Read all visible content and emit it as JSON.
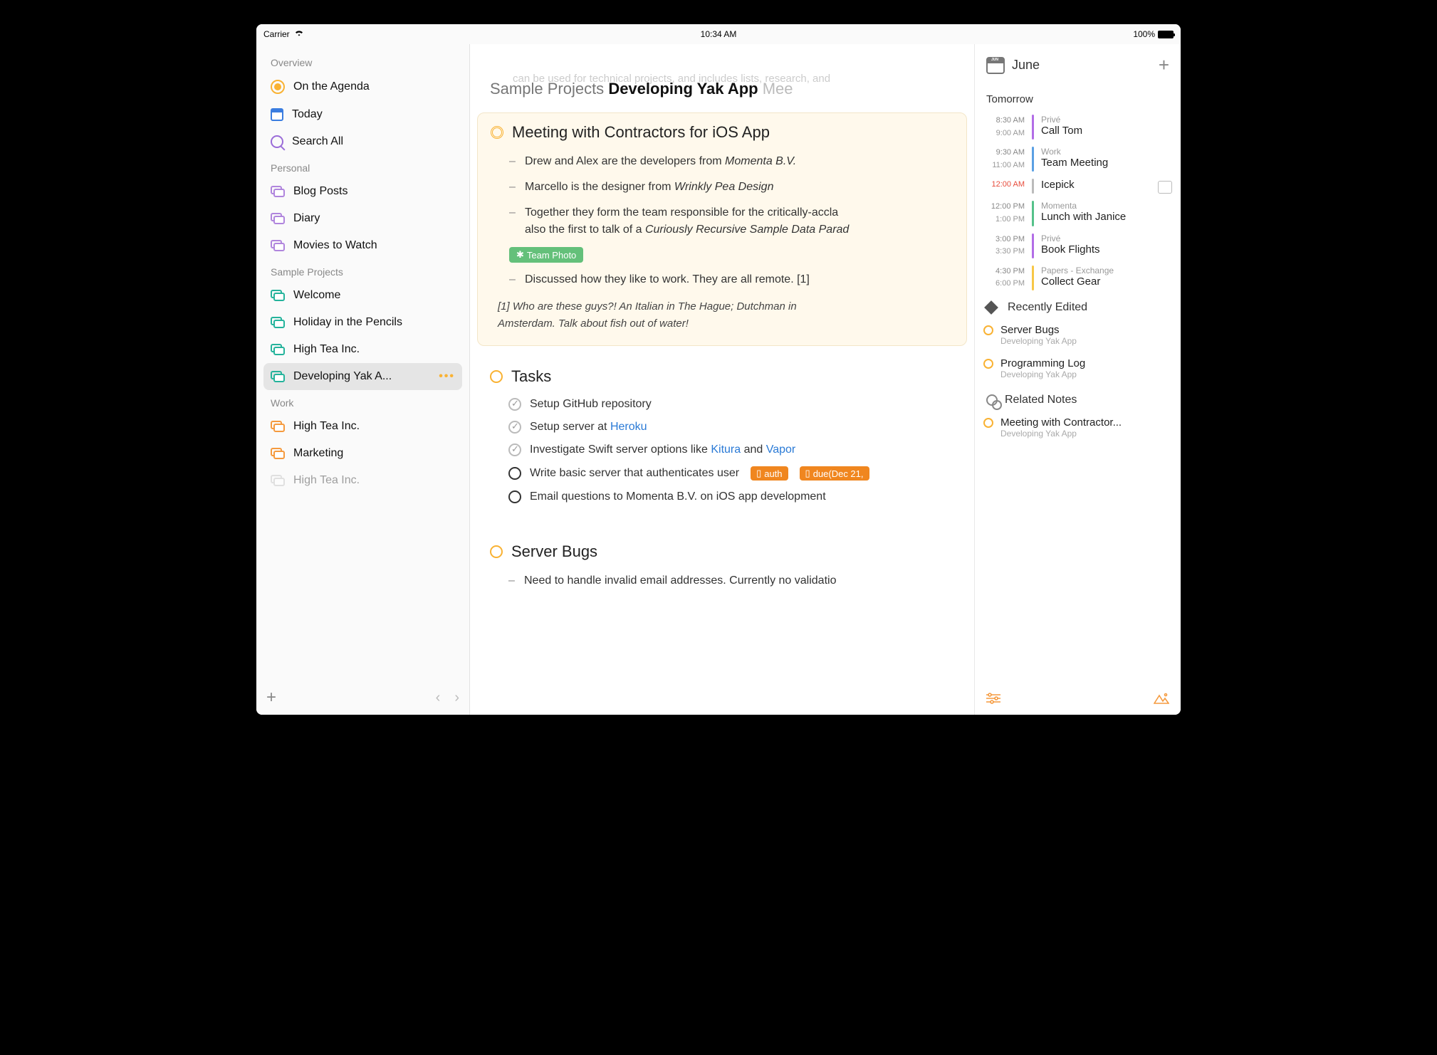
{
  "status": {
    "carrier": "Carrier",
    "time": "10:34 AM",
    "battery_pct": "100%"
  },
  "sidebar": {
    "sections": {
      "overview": "Overview",
      "personal": "Personal",
      "sample": "Sample Projects",
      "work": "Work"
    },
    "overview": [
      {
        "label": "On the Agenda"
      },
      {
        "label": "Today"
      },
      {
        "label": "Search All"
      }
    ],
    "personal": [
      "Blog Posts",
      "Diary",
      "Movies to Watch"
    ],
    "sample": [
      "Welcome",
      "Holiday in the Pencils",
      "High Tea Inc.",
      "Developing Yak A..."
    ],
    "work": [
      "High Tea Inc.",
      "Marketing",
      "High Tea Inc."
    ]
  },
  "breadcrumb": {
    "p1": "Sample Projects",
    "p2": "Developing Yak App",
    "p3": "Mee"
  },
  "faded_lead": "can be used for technical projects, and includes lists, research, and",
  "note1": {
    "title": "Meeting with Contractors for iOS App",
    "lines": [
      {
        "pre": "Drew and Alex are the developers from ",
        "em": "Momenta B.V."
      },
      {
        "pre": "Marcello is the designer from ",
        "em": "Wrinkly Pea Design"
      },
      {
        "pre": "Together they form the team responsible for the critically-accla",
        "pre2": "also the first to talk of a ",
        "em": "Curiously Recursive Sample Data Parad"
      }
    ],
    "tag": "Team Photo",
    "line4": "Discussed how they like to work. They are all remote. [1]",
    "footnote": "[1] Who are these guys?! An Italian in The Hague; Dutchman in ",
    "footnote2": "Amsterdam. Talk about fish out of water!"
  },
  "tasks": {
    "title": "Tasks",
    "items": [
      {
        "done": true,
        "text": "Setup GitHub repository"
      },
      {
        "done": true,
        "pre": "Setup server at ",
        "link": "Heroku"
      },
      {
        "done": true,
        "pre": "Investigate Swift server options like ",
        "link1": "Kitura",
        "mid": " and ",
        "link2": "Vapor"
      },
      {
        "done": false,
        "text": "Write basic server that authenticates user",
        "tag1": "auth",
        "tag2": "due(Dec 21,"
      },
      {
        "done": false,
        "text": "Email questions to Momenta B.V. on iOS app development"
      }
    ]
  },
  "bugs": {
    "title": "Server Bugs",
    "line": "Need to handle invalid email addresses. Currently no validatio"
  },
  "right": {
    "month": "June",
    "month_abbr": "JUN",
    "tomorrow": "Tomorrow",
    "events": [
      {
        "t1": "8:30 AM",
        "t2": "9:00 AM",
        "cal": "Privé",
        "title": "Call Tom",
        "color": "c-purplebar"
      },
      {
        "t1": "9:30 AM",
        "t2": "11:00 AM",
        "cal": "Work",
        "title": "Team Meeting",
        "color": "c-bluebar"
      },
      {
        "t1": "12:00 AM",
        "t2": "",
        "cal": "",
        "title": "Icepick",
        "color": "c-greybar",
        "red": true,
        "note": true
      },
      {
        "t1": "12:00 PM",
        "t2": "1:00 PM",
        "cal": "Momenta",
        "title": "Lunch with Janice",
        "color": "c-greenbar"
      },
      {
        "t1": "3:00 PM",
        "t2": "3:30 PM",
        "cal": "Privé",
        "title": "Book Flights",
        "color": "c-purplebar"
      },
      {
        "t1": "4:30 PM",
        "t2": "6:00 PM",
        "cal": "Papers - Exchange",
        "title": "Collect Gear",
        "color": "c-yellowbar"
      }
    ],
    "recent_title": "Recently Edited",
    "recent": [
      {
        "title": "Server Bugs",
        "sub": "Developing Yak App"
      },
      {
        "title": "Programming Log",
        "sub": "Developing Yak App"
      }
    ],
    "related_title": "Related Notes",
    "related": [
      {
        "title": "Meeting with Contractor...",
        "sub": "Developing Yak App"
      }
    ]
  }
}
